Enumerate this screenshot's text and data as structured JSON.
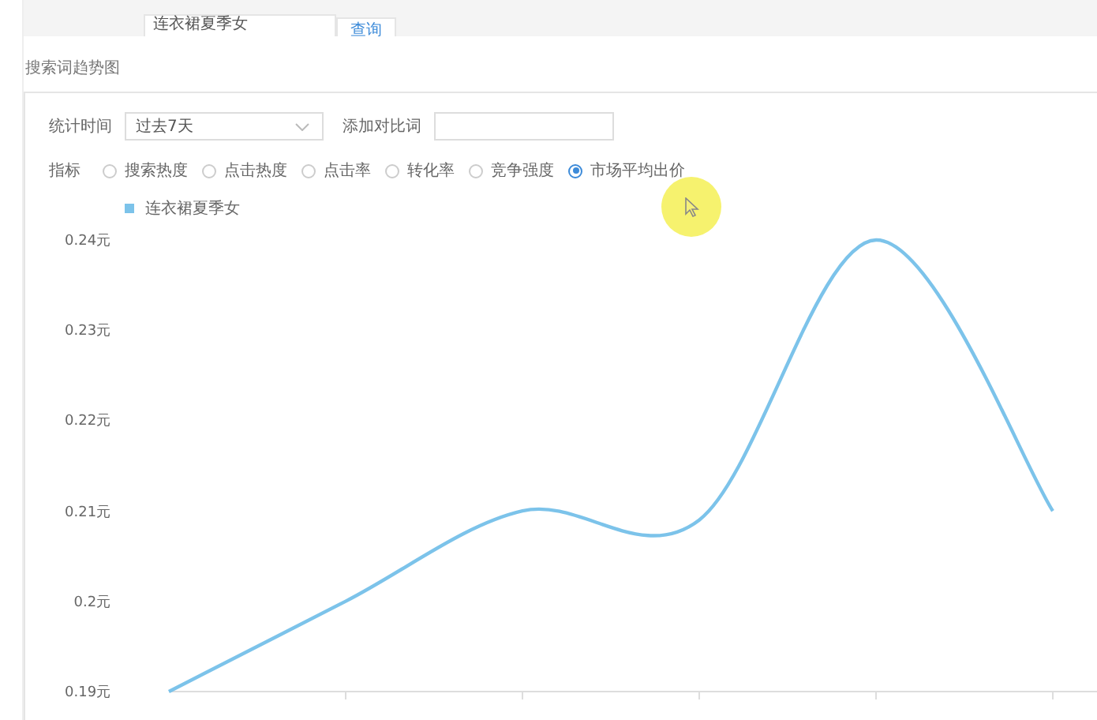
{
  "search_bar": {
    "value": "连衣裙夏季女",
    "button": "查询"
  },
  "section_title": "搜索词趋势图",
  "filters": {
    "period_label": "统计时间",
    "period_value": "过去7天",
    "compare_label": "添加对比词"
  },
  "metric_label": "指标",
  "metrics": [
    {
      "label": "搜索热度",
      "selected": false
    },
    {
      "label": "点击热度",
      "selected": false
    },
    {
      "label": "点击率",
      "selected": false
    },
    {
      "label": "转化率",
      "selected": false
    },
    {
      "label": "竞争强度",
      "selected": false
    },
    {
      "label": "市场平均出价",
      "selected": true
    }
  ],
  "chart_data": {
    "type": "line",
    "series": [
      {
        "name": "连衣裙夏季女",
        "color": "#7cc3ea",
        "values": [
          0.19,
          0.2,
          0.21,
          0.209,
          0.24,
          0.21
        ]
      }
    ],
    "ylim": [
      0.19,
      0.24
    ],
    "yticks": [
      {
        "value": 0.24,
        "label": "0.24元"
      },
      {
        "value": 0.23,
        "label": "0.23元"
      },
      {
        "value": 0.22,
        "label": "0.22元"
      },
      {
        "value": 0.21,
        "label": "0.21元"
      },
      {
        "value": 0.2,
        "label": "0.2元"
      },
      {
        "value": 0.19,
        "label": "0.19元"
      }
    ]
  }
}
